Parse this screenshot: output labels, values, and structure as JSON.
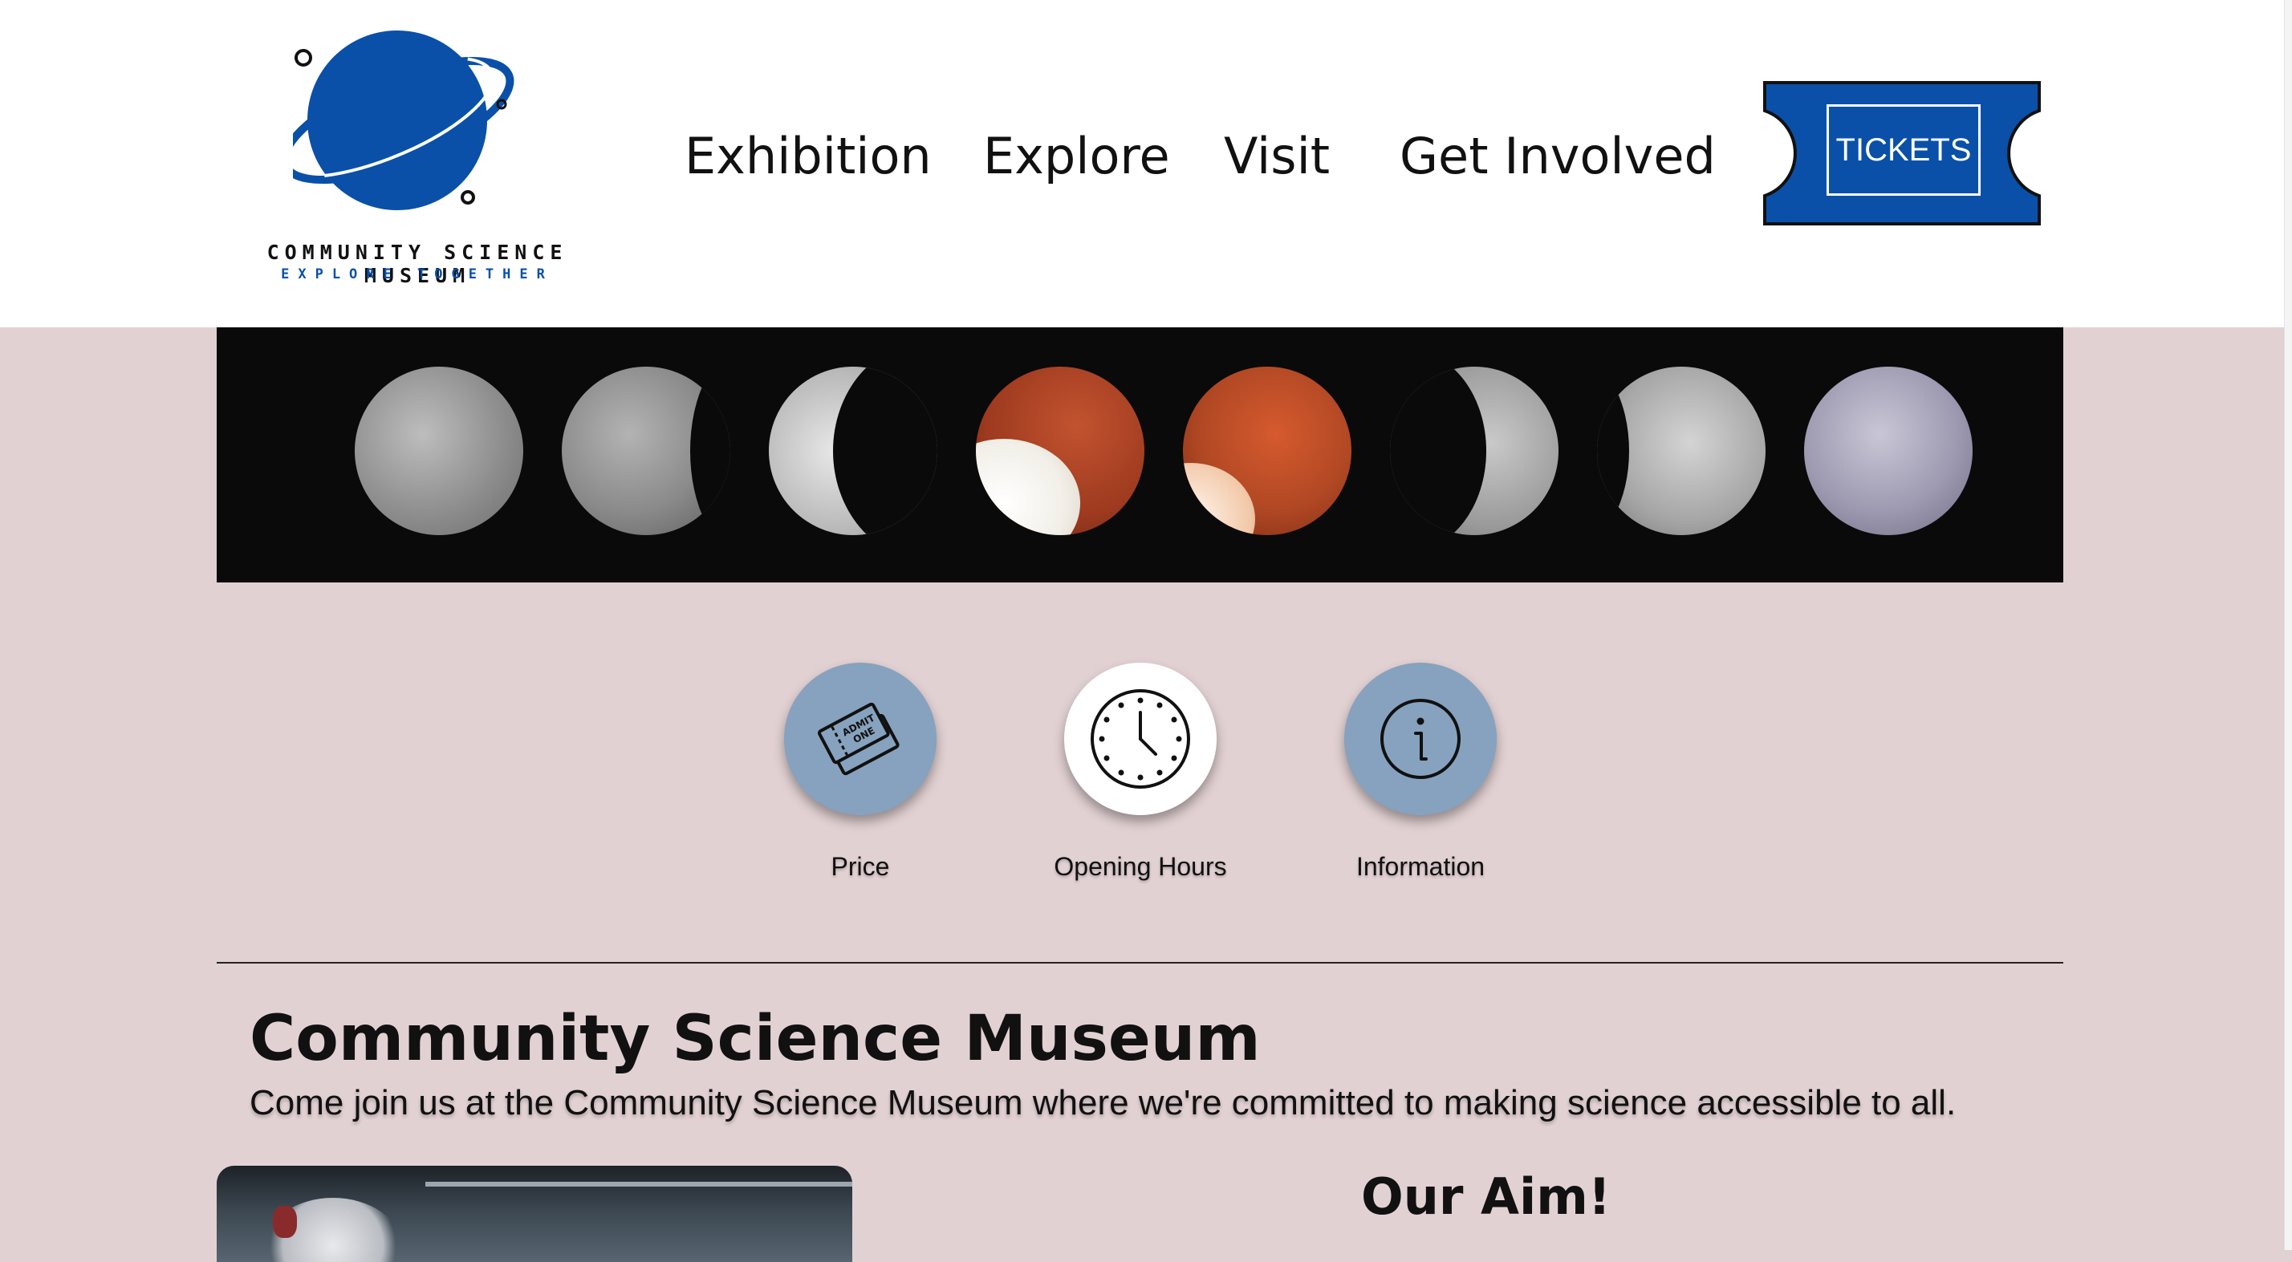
{
  "brand": {
    "name": "COMMUNITY SCIENCE MUSEUM",
    "tagline": "EXPLORE TOGETHER",
    "color": "#0a50a8"
  },
  "nav": {
    "items": [
      {
        "label": "Exhibition"
      },
      {
        "label": "Explore"
      },
      {
        "label": "Visit"
      },
      {
        "label": "Get Involved"
      }
    ],
    "tickets_label": "TICKETS"
  },
  "hero": {
    "icon": "lunar-eclipse-sequence-image",
    "phases": 8
  },
  "quick_links": [
    {
      "label": "Price",
      "icon": "ticket-icon",
      "bg": "#86a2be"
    },
    {
      "label": "Opening Hours",
      "icon": "clock-icon",
      "bg": "#ffffff"
    },
    {
      "label": "Information",
      "icon": "info-icon",
      "bg": "#86a2be"
    }
  ],
  "about": {
    "title": "Community Science Museum",
    "text": "Come join us at the Community Science Museum where we're committed to making science accessible to all."
  },
  "aim": {
    "title": "Our Aim!"
  },
  "colors": {
    "page_bg": "#e2d1d3",
    "header_bg": "#ffffff",
    "tickets_bg": "#0a50a8"
  }
}
